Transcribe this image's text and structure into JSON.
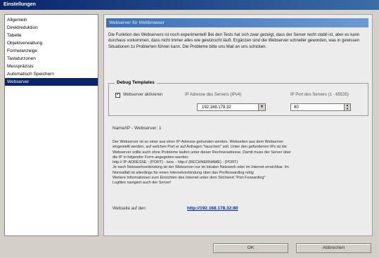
{
  "window": {
    "title": "Einstellungen"
  },
  "sidebar": {
    "items": [
      {
        "label": "Allgemein"
      },
      {
        "label": "Direktreduktion"
      },
      {
        "label": "Tabelle"
      },
      {
        "label": "Objektverwaltung"
      },
      {
        "label": "Formelanzeige"
      },
      {
        "label": "Tastaturzonen"
      },
      {
        "label": "Messpräzisis"
      },
      {
        "label": "Automatisch Speichern"
      },
      {
        "label": "Webserver"
      }
    ],
    "selected_index": 8
  },
  "panel": {
    "header": "Webserver für Webbrowser",
    "intro_text": "Die Funktion des Webservers ist noch experimentell! Bei den Tests hat sich zwar gezeigt, dass der Server recht stabil ist, aber es kann durchaus vorkommen, dass nicht immer alles wie gewünscht läuft. Ergänzen sind die Webserver schneller geworden, was in gewissen Situationen zu Problemen führen kann. Die Probleme bitte uns Mail an uns schicken.",
    "debug": {
      "legend": "Debug Templates",
      "checkbox_label": "Webserver aktivieren",
      "checked": true,
      "ip_header": "IP Adresse des Servers (IPv4)",
      "port_header": "IP Port des Servers (1 - 65535)",
      "ip_value": "192.168.178.32",
      "port_value": "80"
    },
    "status_line": "Name/IP - Webserver: 1",
    "help_lines": [
      "Der Webserver ist so einer aus einer IP-Adresse gebunden werden. Webseiten aus dem Webserver",
      "eingestellt werden, auf welchen Port er auf Anfragen \"lauschen\" soll. Unter den gefundenen IPs ist die",
      "Webserver sollte auch ohne Probleme laufen unter dieser Rechneradresse. Damit muss der Server über",
      "die IP in folgender Form angegeben werden:",
      "http:// IP-ADRESSE : (PORT) - bzw. - http:// (RECHNERNAME) : (PORT)",
      "Je nach Netzwerkverbindung ist der Webserver nur im lokalen Netzwerk oder im Internet erreichbar. Im",
      "Normalfall ist allerdings für einen Internetverbindung über das Portforwarding nötig",
      "Weitere Informationen zum Einrichten des Internet unter dem Stichwort \"Port Forwarding\"",
      "Logfiles navigiert auch der Server!"
    ],
    "webui_label": "Webseite auf den:",
    "webui_link": "http://192.168.178.32:80"
  },
  "buttons": {
    "ok": "OK",
    "cancel": "Abbrechen"
  },
  "colors": {
    "titlebar": "#0a246a",
    "selection": "#0a246a",
    "header_band": "#3a70b6",
    "link": "#0a2a9a"
  }
}
